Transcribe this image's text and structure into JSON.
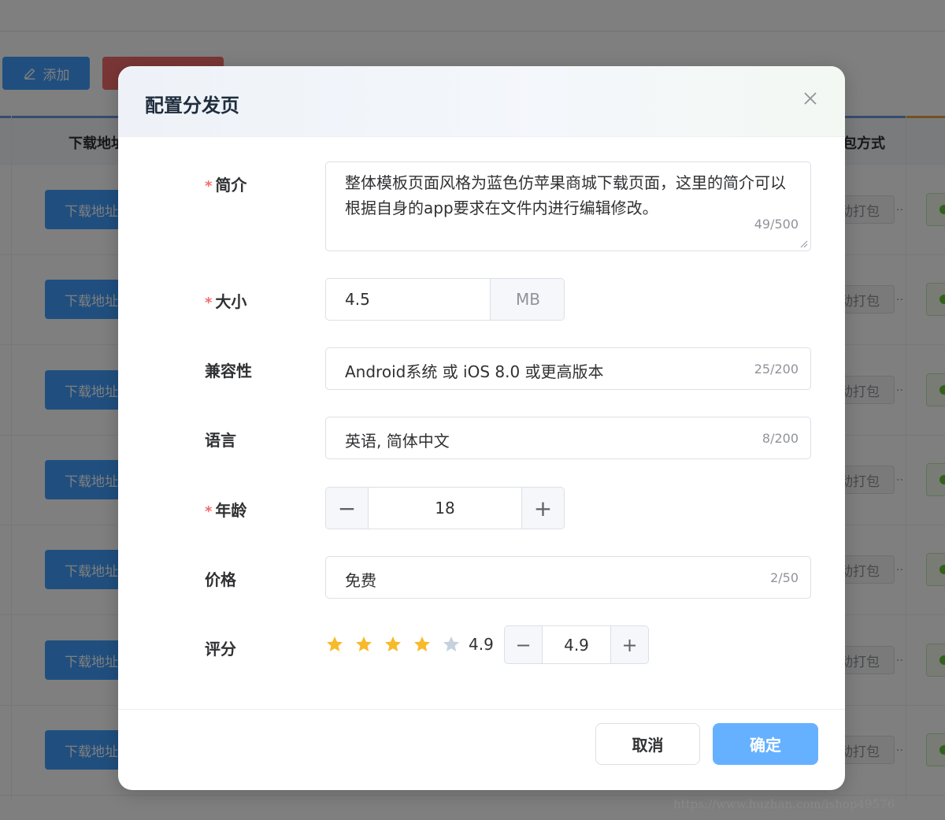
{
  "background": {
    "add_button_label": "添加",
    "table_header_left": "下载地址",
    "table_header_right": "包方式",
    "rows": [
      {
        "download_label": "下载地址",
        "pack_label": "动打包",
        "dots": "··"
      },
      {
        "download_label": "下载地址",
        "pack_label": "动打包",
        "dots": "··"
      },
      {
        "download_label": "下载地址",
        "pack_label": "动打包",
        "dots": "··"
      },
      {
        "download_label": "下载地址",
        "pack_label": "动打包",
        "dots": "··"
      },
      {
        "download_label": "下载地址",
        "pack_label": "动打包",
        "dots": "··"
      },
      {
        "download_label": "下载地址",
        "pack_label": "动打包",
        "dots": "··"
      },
      {
        "download_label": "下载地址",
        "pack_label": "动打包",
        "dots": "··"
      }
    ]
  },
  "dialog": {
    "title": "配置分发页",
    "close_icon": "close-icon",
    "fields": {
      "intro": {
        "label": "简介",
        "required": "*",
        "value": "整体模板页面风格为蓝色仿苹果商城下载页面，这里的简介可以根据自身的app要求在文件内进行编辑修改。",
        "count": "49/500"
      },
      "size": {
        "label": "大小",
        "required": "*",
        "value": "4.5",
        "unit": "MB"
      },
      "compat": {
        "label": "兼容性",
        "value": "Android系统 或 iOS 8.0 或更高版本",
        "count": "25/200"
      },
      "language": {
        "label": "语言",
        "value": "英语, 简体中文",
        "count": "8/200"
      },
      "age": {
        "label": "年龄",
        "required": "*",
        "value": "18",
        "minus": "−",
        "plus": "+"
      },
      "price": {
        "label": "价格",
        "value": "免费",
        "count": "2/50"
      },
      "rating": {
        "label": "评分",
        "stars_filled": 4,
        "stars_total": 5,
        "rating_text": "4.9",
        "stepper_value": "4.9",
        "minus": "−",
        "plus": "+"
      }
    },
    "cancel_label": "取消",
    "ok_label": "确定"
  },
  "colors": {
    "primary": "#409eff",
    "primary_light": "#66b1ff",
    "danger": "#f56c6c",
    "star_on": "#f7ba2a",
    "star_off": "#c6d1de"
  },
  "watermark": "https://www.huzhan.com/ishop49576"
}
